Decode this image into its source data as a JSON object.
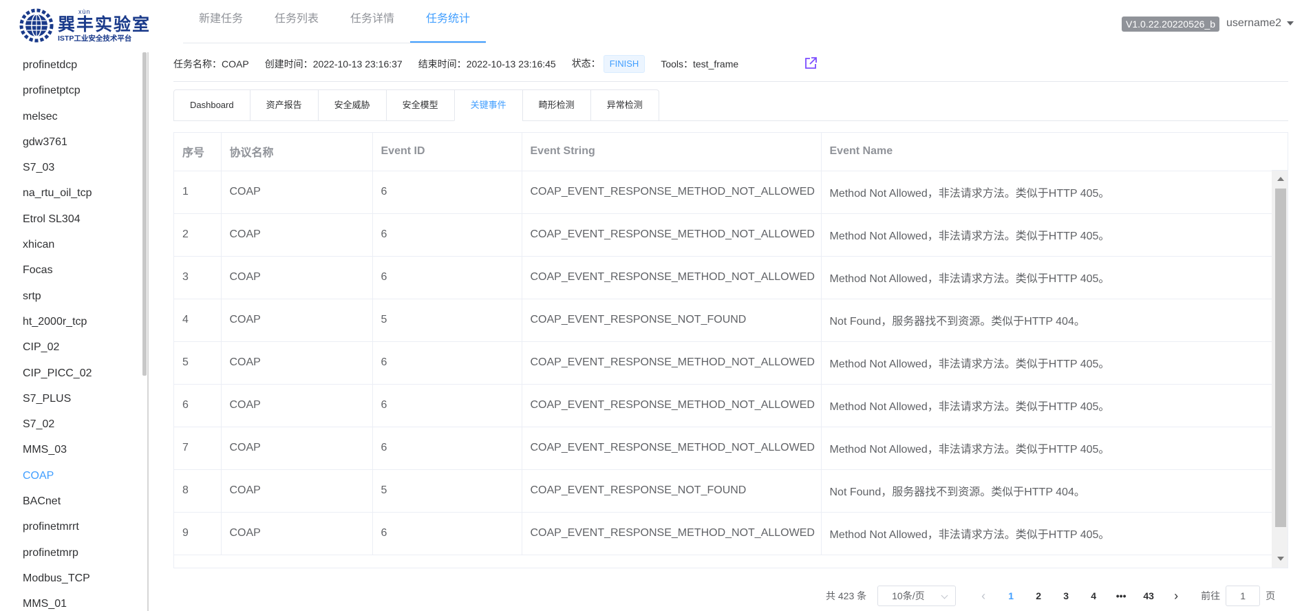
{
  "logo": {
    "pinyin": "xùn",
    "title": "巽丰实验室",
    "subtitle": "ISTP工业安全技术平台"
  },
  "topnav": {
    "items": [
      {
        "label": "新建任务"
      },
      {
        "label": "任务列表"
      },
      {
        "label": "任务详情"
      },
      {
        "label": "任务统计"
      }
    ],
    "active_index": 3
  },
  "version": "V1.0.22.20220526_b",
  "user": {
    "name": "username2"
  },
  "sidebar": {
    "items": [
      {
        "label": "profinetdcp"
      },
      {
        "label": "profinetptcp"
      },
      {
        "label": "melsec"
      },
      {
        "label": "gdw3761"
      },
      {
        "label": "S7_03"
      },
      {
        "label": "na_rtu_oil_tcp"
      },
      {
        "label": "Etrol SL304"
      },
      {
        "label": "xhican"
      },
      {
        "label": "Focas"
      },
      {
        "label": "srtp"
      },
      {
        "label": "ht_2000r_tcp"
      },
      {
        "label": "CIP_02"
      },
      {
        "label": "CIP_PICC_02"
      },
      {
        "label": "S7_PLUS"
      },
      {
        "label": "S7_02"
      },
      {
        "label": "MMS_03"
      },
      {
        "label": "COAP"
      },
      {
        "label": "BACnet"
      },
      {
        "label": "profinetmrrt"
      },
      {
        "label": "profinetmrp"
      },
      {
        "label": "Modbus_TCP"
      },
      {
        "label": "MMS_01"
      }
    ],
    "active_label": "COAP"
  },
  "task_info": {
    "name_label": "任务名称：",
    "name_value": "COAP",
    "created_label": "创建时间：",
    "created_value": "2022-10-13 23:16:37",
    "ended_label": "结束时间：",
    "ended_value": "2022-10-13 23:16:45",
    "status_label": "状态：",
    "status_value": "FINISH",
    "tools_label": "Tools：",
    "tools_value": "test_frame"
  },
  "subtabs": {
    "items": [
      {
        "label": "Dashboard"
      },
      {
        "label": "资产报告"
      },
      {
        "label": "安全威胁"
      },
      {
        "label": "安全模型"
      },
      {
        "label": "关键事件"
      },
      {
        "label": "畸形检测"
      },
      {
        "label": "异常检测"
      }
    ],
    "active_index": 4
  },
  "table": {
    "columns": [
      "序号",
      "协议名称",
      "Event ID",
      "Event String",
      "Event Name"
    ],
    "rows": [
      [
        "1",
        "COAP",
        "6",
        "COAP_EVENT_RESPONSE_METHOD_NOT_ALLOWED",
        "Method Not Allowed，非法请求方法。类似于HTTP 405。"
      ],
      [
        "2",
        "COAP",
        "6",
        "COAP_EVENT_RESPONSE_METHOD_NOT_ALLOWED",
        "Method Not Allowed，非法请求方法。类似于HTTP 405。"
      ],
      [
        "3",
        "COAP",
        "6",
        "COAP_EVENT_RESPONSE_METHOD_NOT_ALLOWED",
        "Method Not Allowed，非法请求方法。类似于HTTP 405。"
      ],
      [
        "4",
        "COAP",
        "5",
        "COAP_EVENT_RESPONSE_NOT_FOUND",
        "Not Found，服务器找不到资源。类似于HTTP 404。"
      ],
      [
        "5",
        "COAP",
        "6",
        "COAP_EVENT_RESPONSE_METHOD_NOT_ALLOWED",
        "Method Not Allowed，非法请求方法。类似于HTTP 405。"
      ],
      [
        "6",
        "COAP",
        "6",
        "COAP_EVENT_RESPONSE_METHOD_NOT_ALLOWED",
        "Method Not Allowed，非法请求方法。类似于HTTP 405。"
      ],
      [
        "7",
        "COAP",
        "6",
        "COAP_EVENT_RESPONSE_METHOD_NOT_ALLOWED",
        "Method Not Allowed，非法请求方法。类似于HTTP 405。"
      ],
      [
        "8",
        "COAP",
        "5",
        "COAP_EVENT_RESPONSE_NOT_FOUND",
        "Not Found，服务器找不到资源。类似于HTTP 404。"
      ],
      [
        "9",
        "COAP",
        "6",
        "COAP_EVENT_RESPONSE_METHOD_NOT_ALLOWED",
        "Method Not Allowed，非法请求方法。类似于HTTP 405。"
      ]
    ]
  },
  "pagination": {
    "total_text": "共 423 条",
    "page_size": "10条/页",
    "pages": [
      "1",
      "2",
      "3",
      "4",
      "•••",
      "43"
    ],
    "current_page": "1",
    "jump_label": "前往",
    "jump_value": "1",
    "jump_suffix": "页",
    "prev_icon": "‹",
    "next_icon": "›"
  },
  "colors": {
    "accent": "#409eff",
    "text": "#606266",
    "muted": "#909399",
    "border": "#ebeef5",
    "badge_bg": "#ecf5ff"
  },
  "icons": {
    "external": "external-link-icon",
    "user_caret": "caret-down-icon"
  }
}
